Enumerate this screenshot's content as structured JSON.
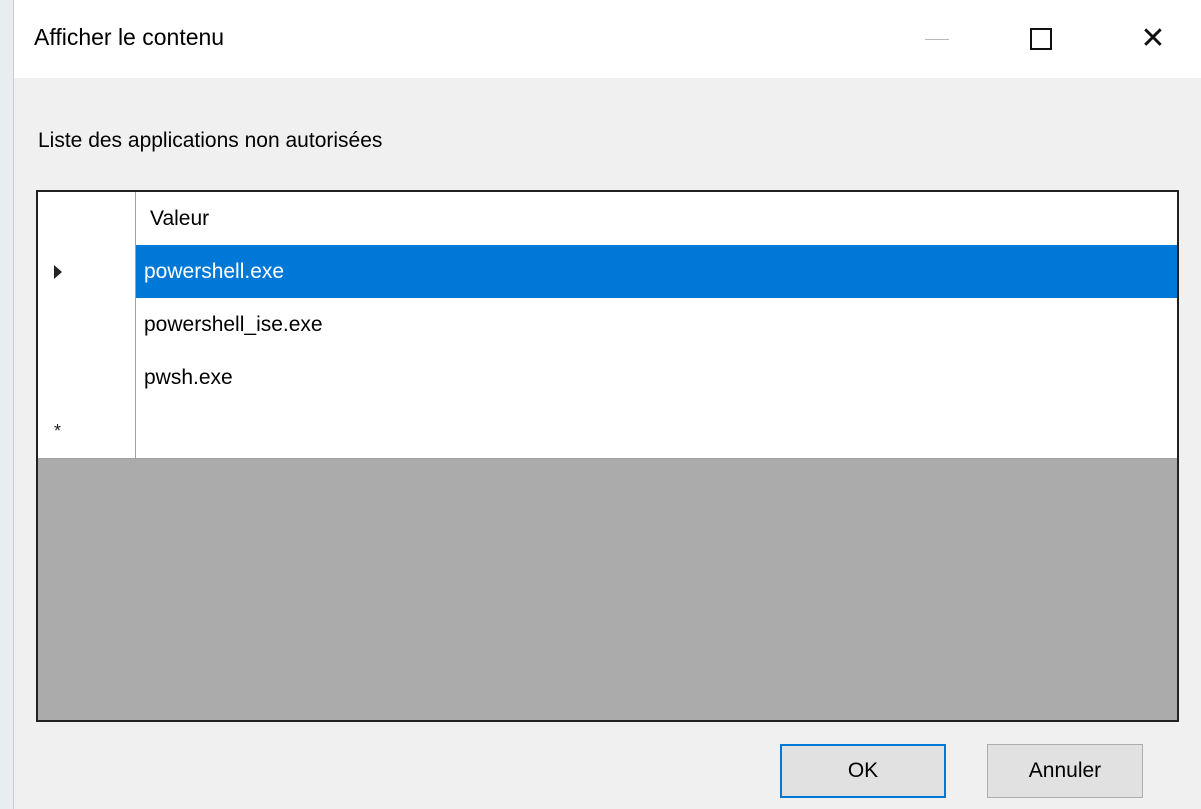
{
  "window": {
    "title": "Afficher le contenu",
    "minimize_icon": "minimize-icon",
    "maximize_icon": "maximize-icon",
    "close_icon": "close-icon",
    "close_glyph": "✕"
  },
  "content": {
    "label": "Liste des applications non autorisées"
  },
  "grid": {
    "column_header": "Valeur",
    "rows": [
      {
        "value": "powershell.exe",
        "selected": true,
        "indicator": "current-row-arrow-icon"
      },
      {
        "value": "powershell_ise.exe",
        "selected": false
      },
      {
        "value": "pwsh.exe",
        "selected": false
      },
      {
        "value": "",
        "new_row": true,
        "indicator": "new-row-asterisk-icon",
        "indicator_glyph": "*"
      }
    ]
  },
  "buttons": {
    "ok_label": "OK",
    "cancel_label": "Annuler"
  },
  "colors": {
    "selection": "#0078d7",
    "dialog_background": "#f0f0f0",
    "titlebar_background": "#ffffff"
  }
}
